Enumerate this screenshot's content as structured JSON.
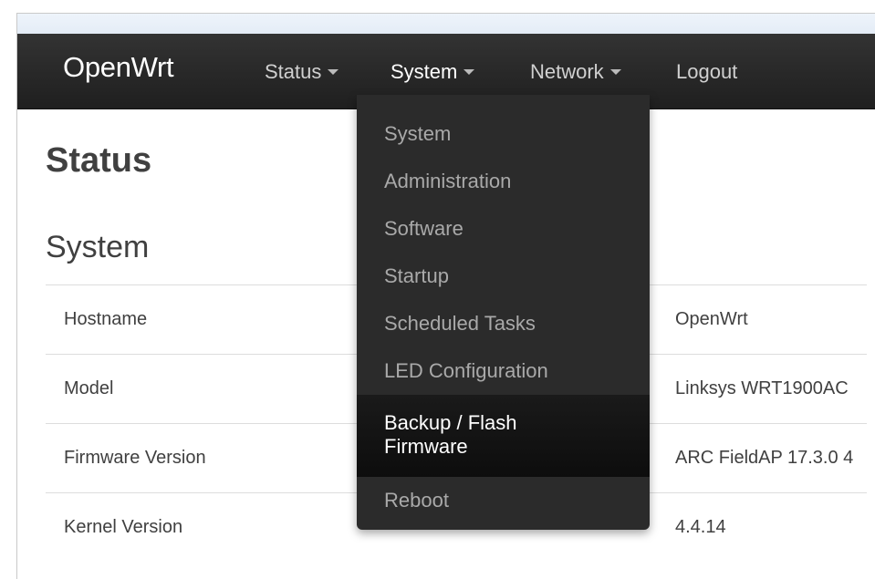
{
  "navbar": {
    "brand": "OpenWrt",
    "items": [
      {
        "label": "Status",
        "has_caret": true
      },
      {
        "label": "System",
        "has_caret": true
      },
      {
        "label": "Network",
        "has_caret": true
      },
      {
        "label": "Logout",
        "has_caret": false
      }
    ]
  },
  "main": {
    "page_title": "Status",
    "section_title": "System",
    "rows": [
      {
        "label": "Hostname",
        "value": "OpenWrt"
      },
      {
        "label": "Model",
        "value": "Linksys WRT1900AC"
      },
      {
        "label": "Firmware Version",
        "value": "ARC FieldAP 17.3.0 4"
      },
      {
        "label": "Kernel Version",
        "value": "4.4.14"
      }
    ]
  },
  "dropdown": {
    "items": [
      {
        "label": "System"
      },
      {
        "label": "Administration"
      },
      {
        "label": "Software"
      },
      {
        "label": "Startup"
      },
      {
        "label": "Scheduled Tasks"
      },
      {
        "label": "LED Configuration"
      },
      {
        "label": "Backup / Flash Firmware",
        "highlighted": true
      },
      {
        "label": "Reboot"
      }
    ]
  },
  "colors": {
    "navbar_bg": "#262626",
    "dropdown_bg": "#2b2b2b",
    "dropdown_text": "#a9a9a9",
    "highlight_text": "#ffffff"
  }
}
